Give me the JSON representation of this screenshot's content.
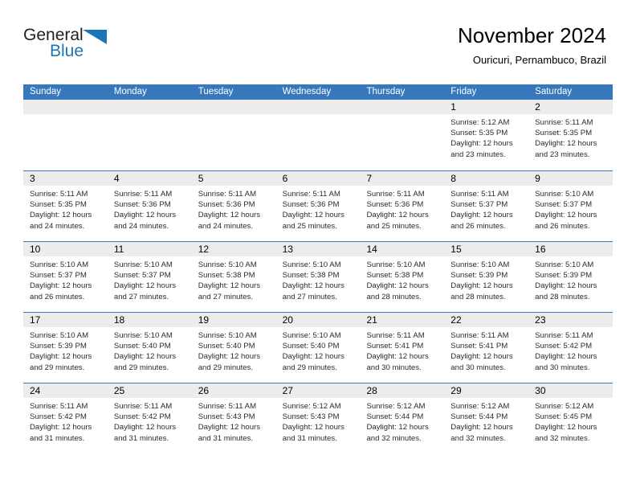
{
  "brand": {
    "name_part1": "General",
    "name_part2": "Blue",
    "accent_color": "#1b75bb"
  },
  "header": {
    "title": "November 2024",
    "subtitle": "Ouricuri, Pernambuco, Brazil"
  },
  "theme": {
    "header_bar_color": "#3778bd",
    "date_band_color": "#ececec",
    "row_divider_color": "#3778bd"
  },
  "calendar": {
    "weekday_headers": [
      "Sunday",
      "Monday",
      "Tuesday",
      "Wednesday",
      "Thursday",
      "Friday",
      "Saturday"
    ],
    "weeks": [
      [
        {
          "day": "",
          "sunrise": "",
          "sunset": "",
          "daylight": "",
          "empty": true
        },
        {
          "day": "",
          "sunrise": "",
          "sunset": "",
          "daylight": "",
          "empty": true
        },
        {
          "day": "",
          "sunrise": "",
          "sunset": "",
          "daylight": "",
          "empty": true
        },
        {
          "day": "",
          "sunrise": "",
          "sunset": "",
          "daylight": "",
          "empty": true
        },
        {
          "day": "",
          "sunrise": "",
          "sunset": "",
          "daylight": "",
          "empty": true
        },
        {
          "day": "1",
          "sunrise": "Sunrise: 5:12 AM",
          "sunset": "Sunset: 5:35 PM",
          "daylight": "Daylight: 12 hours and 23 minutes.",
          "empty": false
        },
        {
          "day": "2",
          "sunrise": "Sunrise: 5:11 AM",
          "sunset": "Sunset: 5:35 PM",
          "daylight": "Daylight: 12 hours and 23 minutes.",
          "empty": false
        }
      ],
      [
        {
          "day": "3",
          "sunrise": "Sunrise: 5:11 AM",
          "sunset": "Sunset: 5:35 PM",
          "daylight": "Daylight: 12 hours and 24 minutes.",
          "empty": false
        },
        {
          "day": "4",
          "sunrise": "Sunrise: 5:11 AM",
          "sunset": "Sunset: 5:36 PM",
          "daylight": "Daylight: 12 hours and 24 minutes.",
          "empty": false
        },
        {
          "day": "5",
          "sunrise": "Sunrise: 5:11 AM",
          "sunset": "Sunset: 5:36 PM",
          "daylight": "Daylight: 12 hours and 24 minutes.",
          "empty": false
        },
        {
          "day": "6",
          "sunrise": "Sunrise: 5:11 AM",
          "sunset": "Sunset: 5:36 PM",
          "daylight": "Daylight: 12 hours and 25 minutes.",
          "empty": false
        },
        {
          "day": "7",
          "sunrise": "Sunrise: 5:11 AM",
          "sunset": "Sunset: 5:36 PM",
          "daylight": "Daylight: 12 hours and 25 minutes.",
          "empty": false
        },
        {
          "day": "8",
          "sunrise": "Sunrise: 5:11 AM",
          "sunset": "Sunset: 5:37 PM",
          "daylight": "Daylight: 12 hours and 26 minutes.",
          "empty": false
        },
        {
          "day": "9",
          "sunrise": "Sunrise: 5:10 AM",
          "sunset": "Sunset: 5:37 PM",
          "daylight": "Daylight: 12 hours and 26 minutes.",
          "empty": false
        }
      ],
      [
        {
          "day": "10",
          "sunrise": "Sunrise: 5:10 AM",
          "sunset": "Sunset: 5:37 PM",
          "daylight": "Daylight: 12 hours and 26 minutes.",
          "empty": false
        },
        {
          "day": "11",
          "sunrise": "Sunrise: 5:10 AM",
          "sunset": "Sunset: 5:37 PM",
          "daylight": "Daylight: 12 hours and 27 minutes.",
          "empty": false
        },
        {
          "day": "12",
          "sunrise": "Sunrise: 5:10 AM",
          "sunset": "Sunset: 5:38 PM",
          "daylight": "Daylight: 12 hours and 27 minutes.",
          "empty": false
        },
        {
          "day": "13",
          "sunrise": "Sunrise: 5:10 AM",
          "sunset": "Sunset: 5:38 PM",
          "daylight": "Daylight: 12 hours and 27 minutes.",
          "empty": false
        },
        {
          "day": "14",
          "sunrise": "Sunrise: 5:10 AM",
          "sunset": "Sunset: 5:38 PM",
          "daylight": "Daylight: 12 hours and 28 minutes.",
          "empty": false
        },
        {
          "day": "15",
          "sunrise": "Sunrise: 5:10 AM",
          "sunset": "Sunset: 5:39 PM",
          "daylight": "Daylight: 12 hours and 28 minutes.",
          "empty": false
        },
        {
          "day": "16",
          "sunrise": "Sunrise: 5:10 AM",
          "sunset": "Sunset: 5:39 PM",
          "daylight": "Daylight: 12 hours and 28 minutes.",
          "empty": false
        }
      ],
      [
        {
          "day": "17",
          "sunrise": "Sunrise: 5:10 AM",
          "sunset": "Sunset: 5:39 PM",
          "daylight": "Daylight: 12 hours and 29 minutes.",
          "empty": false
        },
        {
          "day": "18",
          "sunrise": "Sunrise: 5:10 AM",
          "sunset": "Sunset: 5:40 PM",
          "daylight": "Daylight: 12 hours and 29 minutes.",
          "empty": false
        },
        {
          "day": "19",
          "sunrise": "Sunrise: 5:10 AM",
          "sunset": "Sunset: 5:40 PM",
          "daylight": "Daylight: 12 hours and 29 minutes.",
          "empty": false
        },
        {
          "day": "20",
          "sunrise": "Sunrise: 5:10 AM",
          "sunset": "Sunset: 5:40 PM",
          "daylight": "Daylight: 12 hours and 29 minutes.",
          "empty": false
        },
        {
          "day": "21",
          "sunrise": "Sunrise: 5:11 AM",
          "sunset": "Sunset: 5:41 PM",
          "daylight": "Daylight: 12 hours and 30 minutes.",
          "empty": false
        },
        {
          "day": "22",
          "sunrise": "Sunrise: 5:11 AM",
          "sunset": "Sunset: 5:41 PM",
          "daylight": "Daylight: 12 hours and 30 minutes.",
          "empty": false
        },
        {
          "day": "23",
          "sunrise": "Sunrise: 5:11 AM",
          "sunset": "Sunset: 5:42 PM",
          "daylight": "Daylight: 12 hours and 30 minutes.",
          "empty": false
        }
      ],
      [
        {
          "day": "24",
          "sunrise": "Sunrise: 5:11 AM",
          "sunset": "Sunset: 5:42 PM",
          "daylight": "Daylight: 12 hours and 31 minutes.",
          "empty": false
        },
        {
          "day": "25",
          "sunrise": "Sunrise: 5:11 AM",
          "sunset": "Sunset: 5:42 PM",
          "daylight": "Daylight: 12 hours and 31 minutes.",
          "empty": false
        },
        {
          "day": "26",
          "sunrise": "Sunrise: 5:11 AM",
          "sunset": "Sunset: 5:43 PM",
          "daylight": "Daylight: 12 hours and 31 minutes.",
          "empty": false
        },
        {
          "day": "27",
          "sunrise": "Sunrise: 5:12 AM",
          "sunset": "Sunset: 5:43 PM",
          "daylight": "Daylight: 12 hours and 31 minutes.",
          "empty": false
        },
        {
          "day": "28",
          "sunrise": "Sunrise: 5:12 AM",
          "sunset": "Sunset: 5:44 PM",
          "daylight": "Daylight: 12 hours and 32 minutes.",
          "empty": false
        },
        {
          "day": "29",
          "sunrise": "Sunrise: 5:12 AM",
          "sunset": "Sunset: 5:44 PM",
          "daylight": "Daylight: 12 hours and 32 minutes.",
          "empty": false
        },
        {
          "day": "30",
          "sunrise": "Sunrise: 5:12 AM",
          "sunset": "Sunset: 5:45 PM",
          "daylight": "Daylight: 12 hours and 32 minutes.",
          "empty": false
        }
      ]
    ]
  }
}
